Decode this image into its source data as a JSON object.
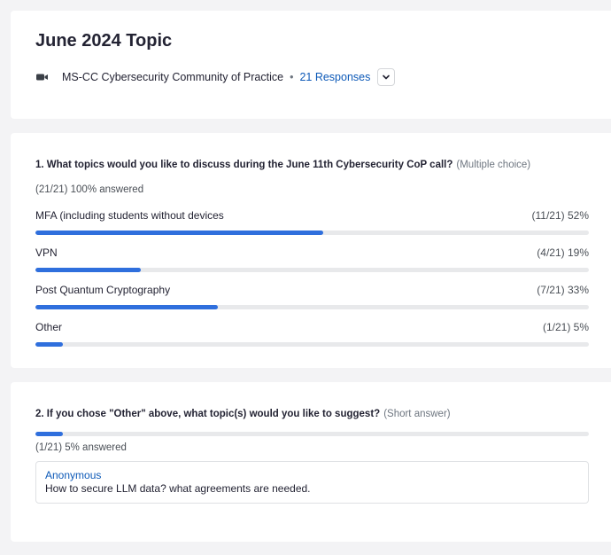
{
  "header": {
    "title": "June 2024 Topic",
    "org": "MS-CC Cybersecurity Community of Practice",
    "separator": "•",
    "responses": "21 Responses"
  },
  "q1": {
    "title": "1. What topics would you like to discuss during the June 11th Cybersecurity CoP call?",
    "type": "(Multiple choice)",
    "answered": "(21/21) 100% answered",
    "options": [
      {
        "label": "MFA (including students without devices",
        "stat": "(11/21) 52%",
        "percent": 52
      },
      {
        "label": "VPN",
        "stat": "(4/21) 19%",
        "percent": 19
      },
      {
        "label": "Post Quantum Cryptography",
        "stat": "(7/21) 33%",
        "percent": 33
      },
      {
        "label": "Other",
        "stat": "(1/21) 5%",
        "percent": 5
      }
    ]
  },
  "q2": {
    "title": "2. If you chose \"Other\" above, what topic(s) would you like to suggest?",
    "type": "(Short answer)",
    "percent": 5,
    "answered": "(1/21) 5% answered",
    "response": {
      "name": "Anonymous",
      "text": "How to secure LLM data? what agreements are needed."
    }
  },
  "colors": {
    "accent": "#2f6fdd",
    "link": "#0e5ab8",
    "track": "#e8e9eb"
  },
  "icons": {
    "meeting": "video-camera-icon",
    "expand": "chevron-down-icon"
  }
}
